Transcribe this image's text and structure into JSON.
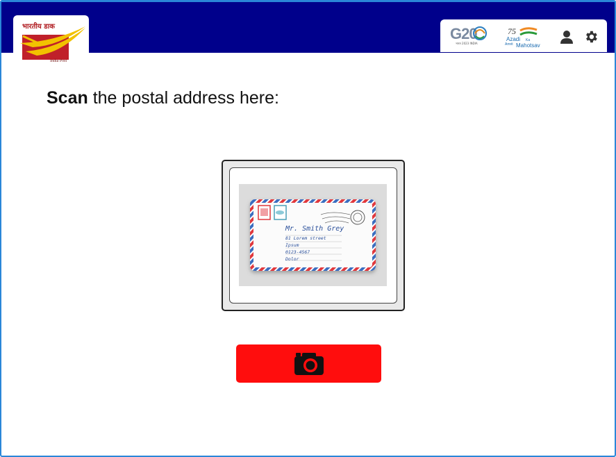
{
  "header": {
    "logo": {
      "hindi_text": "भारतीय डाक",
      "caption": "India Post",
      "icon": "india-post-logo"
    },
    "badges": {
      "g20": {
        "text": "G20",
        "sub": "भारत 2023 INDIA"
      },
      "azadi": {
        "number": "75",
        "line1": "Azadi",
        "line2": "Amrit",
        "line3": "Mahotsav",
        "ka": "Ka"
      }
    },
    "icons": {
      "user": "user-icon",
      "settings": "gear-icon"
    },
    "colors": {
      "bar": "#00008b",
      "accent": "#2a86d8"
    }
  },
  "main": {
    "prompt_bold": "Scan",
    "prompt_rest": " the postal address here:",
    "envelope": {
      "name": "Mr. Smith Grey",
      "line1": "81 Lorem street",
      "line2": "Ipsum",
      "line3": "0123-4567",
      "line4": "Dolor"
    },
    "capture_button": {
      "icon": "camera-icon",
      "color": "#ff0d0d"
    }
  }
}
